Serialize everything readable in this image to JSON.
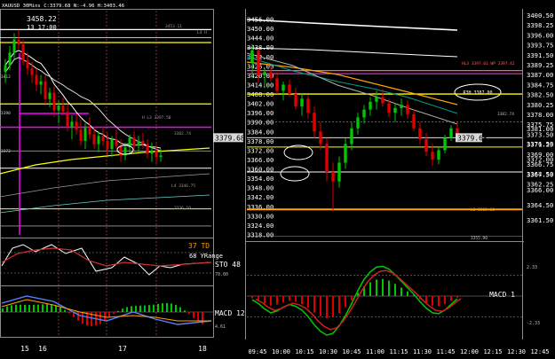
{
  "header": {
    "symbol": "XAUUSD",
    "timeframe": "30Mins",
    "quote": "C:3379.68 N:-4.96 H:3403.46"
  },
  "left_main": {
    "high_label": "3458.22",
    "time_label": "13 17:00",
    "left_tags": [
      "3412",
      "3390",
      "3372"
    ],
    "level_labels": [
      "3453.11",
      "L4 H",
      "H L3 3397.50",
      "3382.74",
      "L4 3346.75",
      "3336.10"
    ],
    "x_labels": [
      "15",
      "16",
      "17",
      "18"
    ]
  },
  "left_ind": {
    "td_label": "37 TD",
    "yrange_label": "68 YRange",
    "sto_label": "STO 48",
    "sto_tag": "70.00",
    "macd_label": "MACD 12",
    "macd_tag": "4.61"
  },
  "right_main": {
    "price_ticks": [
      "3456.00",
      "3450.00",
      "3444.00",
      "3438.00",
      "3432.00",
      "3426.00",
      "3420.00",
      "3414.00",
      "3408.00",
      "3402.00",
      "3396.00",
      "3390.00",
      "3384.00",
      "3378.00",
      "3372.00",
      "3366.00",
      "3360.00",
      "3354.00",
      "3348.00",
      "3342.00",
      "3336.00",
      "3330.00",
      "3324.00",
      "3318.00"
    ],
    "axis_ticks": [
      "3400.50",
      "3398.25",
      "3396.00",
      "3393.75",
      "3391.50",
      "3389.25",
      "3387.00",
      "3384.75",
      "3382.50",
      "3380.25",
      "3378.00",
      "3375.75",
      "3373.50",
      "3371.25",
      "3369.00",
      "3366.75",
      "3364.50",
      "3362.25"
    ],
    "axis_ticks_low": [
      "3381.00",
      "3376.50",
      "3372.00",
      "3367.50",
      "3366.00",
      "3364.50",
      "3361.50"
    ],
    "current_price": "3379.68",
    "level_labels": [
      "HL3 3397.61  WP 3397.42",
      "3382.74",
      "L3 3365.68",
      "3355.90"
    ],
    "annotation": "R3H 3387.00",
    "x_labels": [
      "09:45",
      "10:00",
      "10:15",
      "10:30",
      "10:45",
      "11:00",
      "11:15",
      "11:30",
      "11:45",
      "12:00",
      "12:15",
      "12:30",
      "12:45"
    ],
    "macd_label": "MACD 1",
    "macd_ticks": [
      "2.33",
      "-2.33"
    ]
  },
  "colors": {
    "bull": "#00c800",
    "bear": "#e00000",
    "yellow": "#ffff00",
    "orange": "#ffa500",
    "magenta": "#ff00ff",
    "grey": "#9a9a9a",
    "teal": "#00a08a",
    "white": "#ffffff"
  },
  "chart_data": {
    "type": "candlestick",
    "symbol": "XAUUSD",
    "timeframe": "30Mins",
    "panels": [
      {
        "name": "left-overview",
        "x_labels": [
          "15",
          "16",
          "17",
          "18"
        ],
        "ylim": [
          3330,
          3470
        ],
        "candles": [
          [
            3432,
            3440,
            3425,
            3436
          ],
          [
            3436,
            3448,
            3433,
            3444
          ],
          [
            3444,
            3456,
            3440,
            3452
          ],
          [
            3452,
            3458,
            3446,
            3449
          ],
          [
            3449,
            3452,
            3436,
            3439
          ],
          [
            3439,
            3444,
            3430,
            3434
          ],
          [
            3434,
            3438,
            3425,
            3430
          ],
          [
            3430,
            3434,
            3420,
            3424
          ],
          [
            3424,
            3430,
            3418,
            3426
          ],
          [
            3426,
            3430,
            3412,
            3415
          ],
          [
            3415,
            3422,
            3410,
            3419
          ],
          [
            3419,
            3423,
            3404,
            3408
          ],
          [
            3408,
            3414,
            3400,
            3411
          ],
          [
            3411,
            3416,
            3405,
            3407
          ],
          [
            3407,
            3412,
            3395,
            3398
          ],
          [
            3398,
            3405,
            3390,
            3401
          ],
          [
            3401,
            3406,
            3393,
            3396
          ],
          [
            3396,
            3402,
            3386,
            3389
          ],
          [
            3389,
            3400,
            3384,
            3397
          ],
          [
            3397,
            3404,
            3390,
            3393
          ],
          [
            3393,
            3398,
            3384,
            3387
          ],
          [
            3387,
            3395,
            3382,
            3392
          ],
          [
            3392,
            3398,
            3386,
            3389
          ],
          [
            3389,
            3394,
            3380,
            3384
          ],
          [
            3384,
            3392,
            3379,
            3390
          ],
          [
            3390,
            3396,
            3384,
            3386
          ],
          [
            3386,
            3390,
            3376,
            3380
          ],
          [
            3380,
            3388,
            3377,
            3385
          ],
          [
            3385,
            3393,
            3381,
            3391
          ],
          [
            3391,
            3395,
            3383,
            3386
          ],
          [
            3386,
            3392,
            3382,
            3389
          ],
          [
            3389,
            3394,
            3384,
            3387
          ],
          [
            3387,
            3390,
            3378,
            3381
          ],
          [
            3381,
            3388,
            3376,
            3383
          ],
          [
            3383,
            3387,
            3375,
            3379
          ],
          [
            3379,
            3384,
            3376,
            3380
          ]
        ],
        "levels": [
          3458.22,
          3453.11,
          3412,
          3397.5,
          3382.74,
          3372,
          3346.75,
          3336.1
        ]
      },
      {
        "name": "right-intraday",
        "x_labels": [
          "09:45",
          "10:00",
          "10:15",
          "10:30",
          "10:45",
          "11:00",
          "11:15",
          "11:30",
          "11:45",
          "12:00",
          "12:15",
          "12:30",
          "12:45"
        ],
        "ylim": [
          3316,
          3458
        ],
        "candles": [
          [
            3428,
            3440,
            3418,
            3436
          ],
          [
            3436,
            3437,
            3415,
            3420
          ],
          [
            3420,
            3425,
            3412,
            3422
          ],
          [
            3422,
            3426,
            3416,
            3418
          ],
          [
            3418,
            3422,
            3408,
            3410
          ],
          [
            3410,
            3416,
            3404,
            3414
          ],
          [
            3414,
            3417,
            3406,
            3408
          ],
          [
            3408,
            3412,
            3398,
            3400
          ],
          [
            3400,
            3408,
            3394,
            3405
          ],
          [
            3405,
            3407,
            3392,
            3396
          ],
          [
            3396,
            3400,
            3380,
            3384
          ],
          [
            3384,
            3390,
            3372,
            3376
          ],
          [
            3376,
            3380,
            3352,
            3358
          ],
          [
            3358,
            3364,
            3333,
            3352
          ],
          [
            3352,
            3368,
            3348,
            3364
          ],
          [
            3364,
            3380,
            3360,
            3376
          ],
          [
            3376,
            3390,
            3372,
            3386
          ],
          [
            3386,
            3396,
            3382,
            3393
          ],
          [
            3393,
            3401,
            3389,
            3398
          ],
          [
            3398,
            3406,
            3394,
            3403
          ],
          [
            3403,
            3410,
            3398,
            3406
          ],
          [
            3406,
            3411,
            3400,
            3402
          ],
          [
            3402,
            3405,
            3393,
            3396
          ],
          [
            3396,
            3402,
            3390,
            3399
          ],
          [
            3399,
            3405,
            3394,
            3401
          ],
          [
            3401,
            3404,
            3392,
            3395
          ],
          [
            3395,
            3398,
            3384,
            3386
          ],
          [
            3386,
            3390,
            3376,
            3379
          ],
          [
            3379,
            3383,
            3368,
            3371
          ],
          [
            3371,
            3376,
            3362,
            3366
          ],
          [
            3366,
            3374,
            3363,
            3372
          ],
          [
            3372,
            3382,
            3370,
            3380
          ],
          [
            3380,
            3388,
            3378,
            3386
          ],
          [
            3386,
            3390,
            3378,
            3380
          ]
        ],
        "levels": [
          {
            "label": "HL3 3397.61",
            "value": 3423
          },
          {
            "label": "WP 3397.42",
            "value": 3421
          },
          {
            "label": "R3H 3387.00",
            "value": 3408
          },
          {
            "label": "3382.74",
            "value": 3390
          },
          {
            "label": "3379.68",
            "value": 3380
          },
          {
            "label": "",
            "value": 3374
          },
          {
            "label": "",
            "value": 3358
          },
          {
            "label": "L3 3365.68",
            "value": 3334
          },
          {
            "label": "3355.90",
            "value": 3317
          }
        ]
      }
    ],
    "indicators": {
      "TD": 37,
      "YRange": 68,
      "STO": 48,
      "sto_levels": [
        70,
        30
      ],
      "macd_ticks": [
        2.33,
        -2.33
      ],
      "macd_values": [
        -0.4,
        -0.8,
        -1.4,
        -1.8,
        -1.6,
        -1.2,
        -0.9,
        -1.1,
        -1.5,
        -2.2,
        -3.1,
        -3.8,
        -4.2,
        -4.0,
        -3.2,
        -2.1,
        -0.8,
        0.6,
        1.8,
        2.6,
        3.1,
        3.2,
        2.9,
        2.3,
        1.6,
        0.9,
        0.2,
        -0.6,
        -1.3,
        -1.8,
        -1.9,
        -1.5,
        -0.9,
        -0.3
      ]
    }
  }
}
